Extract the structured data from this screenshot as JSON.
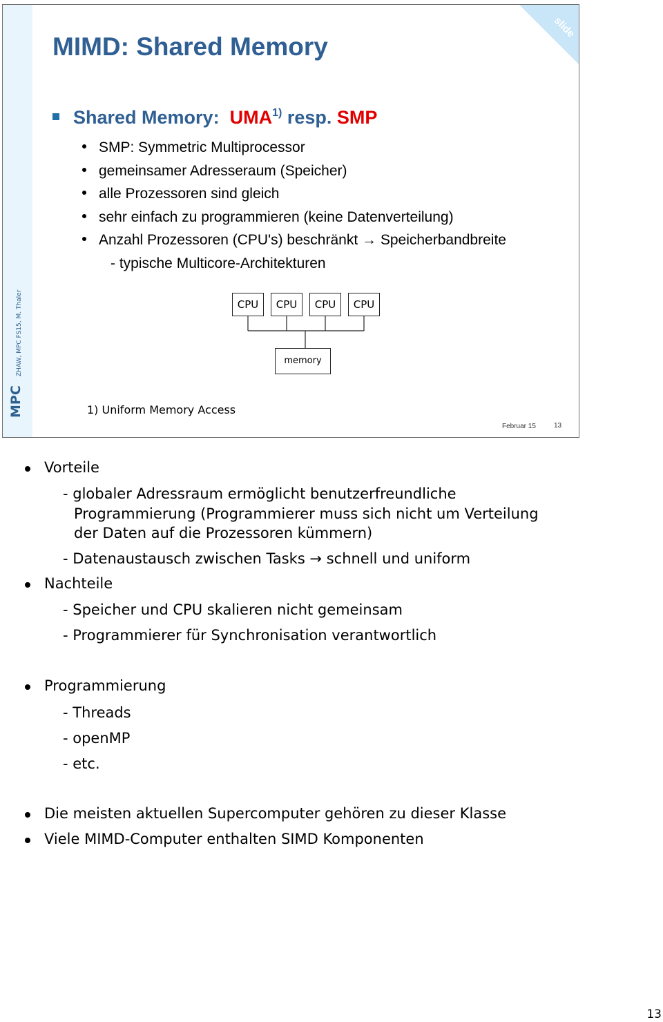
{
  "slide": {
    "title": "MIMD: Shared Memory",
    "corner_label": "slide",
    "sidebar_label": "MPC",
    "sidebar_credit": "ZHAW, MPC FS15, M. Thaler",
    "heading": {
      "prefix": "Shared Memory:",
      "uma": "UMA",
      "uma_sup": "1)",
      "middle": "resp.",
      "smp": "SMP"
    },
    "bullets": [
      "SMP: Symmetric Multiprocessor",
      "gemeinsamer Adresseraum (Speicher)",
      "alle Prozessoren sind gleich",
      "sehr einfach zu programmieren (keine Datenverteilung)",
      "Anzahl Prozessoren (CPU's) beschränkt → Speicherbandbreite"
    ],
    "sub_bullet": "-  typische Multicore-Architekturen",
    "diagram": {
      "cpus": [
        "CPU",
        "CPU",
        "CPU",
        "CPU"
      ],
      "memory": "memory"
    },
    "footnote": "1) Uniform Memory Access",
    "footer_date": "Februar 15",
    "footer_page": "13"
  },
  "notes": {
    "vorteile": {
      "label": "Vorteile",
      "items": [
        [
          "- globaler Adressraum ermöglicht benutzerfreundliche",
          "Programmierung (Programmierer muss sich nicht um Verteilung",
          "der Daten auf die Prozessoren kümmern)"
        ],
        [
          "- Datenaustausch zwischen Tasks → schnell und uniform"
        ]
      ]
    },
    "nachteile": {
      "label": "Nachteile",
      "items": [
        "- Speicher und CPU skalieren nicht gemeinsam",
        "- Programmierer für Synchronisation verantwortlich"
      ]
    },
    "programmierung": {
      "label": "Programmierung",
      "items": [
        "- Threads",
        "- openMP",
        "- etc."
      ]
    },
    "closing": [
      "Die meisten aktuellen Supercomputer gehören zu dieser Klasse",
      "Viele MIMD-Computer enthalten SIMD Komponenten"
    ]
  },
  "page_number": "13"
}
